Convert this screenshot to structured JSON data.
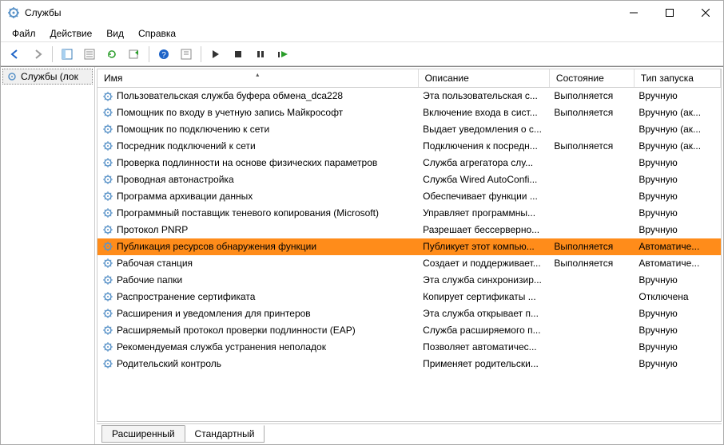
{
  "window": {
    "title": "Службы"
  },
  "menu": {
    "file": "Файл",
    "action": "Действие",
    "view": "Вид",
    "help": "Справка"
  },
  "sidebar": {
    "item": "Службы (лок"
  },
  "columns": {
    "name": "Имя",
    "desc": "Описание",
    "state": "Состояние",
    "start": "Тип запуска"
  },
  "tabs": {
    "ext": "Расширенный",
    "std": "Стандартный"
  },
  "rows": [
    {
      "name": "Пользовательская служба буфера обмена_dca228",
      "desc": "Эта пользовательская с...",
      "state": "Выполняется",
      "start": "Вручную"
    },
    {
      "name": "Помощник по входу в учетную запись Майкрософт",
      "desc": "Включение входа в сист...",
      "state": "Выполняется",
      "start": "Вручную (ак..."
    },
    {
      "name": "Помощник по подключению к сети",
      "desc": "Выдает уведомления о с...",
      "state": "",
      "start": "Вручную (ак..."
    },
    {
      "name": "Посредник подключений к сети",
      "desc": "Подключения к посредн...",
      "state": "Выполняется",
      "start": "Вручную (ак..."
    },
    {
      "name": "Проверка подлинности на основе физических параметров",
      "desc": "Служба агрегатора слу...",
      "state": "",
      "start": "Вручную"
    },
    {
      "name": "Проводная автонастройка",
      "desc": "Служба Wired AutoConfi...",
      "state": "",
      "start": "Вручную"
    },
    {
      "name": "Программа архивации данных",
      "desc": "Обеспечивает функции ...",
      "state": "",
      "start": "Вручную"
    },
    {
      "name": "Программный поставщик теневого копирования (Microsoft)",
      "desc": "Управляет программны...",
      "state": "",
      "start": "Вручную"
    },
    {
      "name": "Протокол PNRP",
      "desc": "Разрешает бессерверно...",
      "state": "",
      "start": "Вручную"
    },
    {
      "name": "Публикация ресурсов обнаружения функции",
      "desc": "Публикует этот компью...",
      "state": "Выполняется",
      "start": "Автоматиче...",
      "selected": true
    },
    {
      "name": "Рабочая станция",
      "desc": "Создает и поддерживает...",
      "state": "Выполняется",
      "start": "Автоматиче..."
    },
    {
      "name": "Рабочие папки",
      "desc": "Эта служба синхронизир...",
      "state": "",
      "start": "Вручную"
    },
    {
      "name": "Распространение сертификата",
      "desc": "Копирует сертификаты ...",
      "state": "",
      "start": "Отключена"
    },
    {
      "name": "Расширения и уведомления для принтеров",
      "desc": "Эта служба открывает п...",
      "state": "",
      "start": "Вручную"
    },
    {
      "name": "Расширяемый протокол проверки подлинности (EAP)",
      "desc": "Служба расширяемого п...",
      "state": "",
      "start": "Вручную"
    },
    {
      "name": "Рекомендуемая служба устранения неполадок",
      "desc": "Позволяет автоматичес...",
      "state": "",
      "start": "Вручную"
    },
    {
      "name": "Родительский контроль",
      "desc": "Применяет родительски...",
      "state": "",
      "start": "Вручную"
    }
  ]
}
